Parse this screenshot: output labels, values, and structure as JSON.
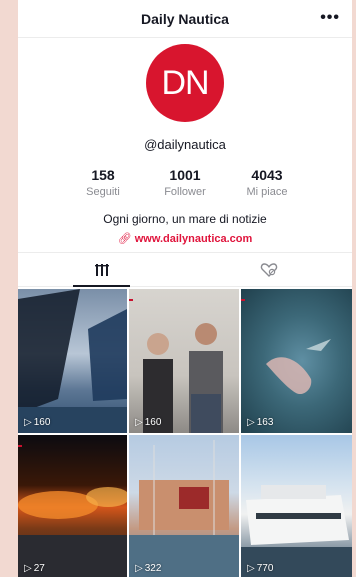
{
  "header": {
    "title": "Daily Nautica",
    "more_label": "•••"
  },
  "profile": {
    "avatar_text": "DN",
    "handle": "@dailynautica",
    "stats": [
      {
        "value": "158",
        "label": "Seguiti"
      },
      {
        "value": "1001",
        "label": "Follower"
      },
      {
        "value": "4043",
        "label": "Mi piace"
      }
    ],
    "bio": "Ogni giorno, un mare di notizie",
    "link": "www.dailynautica.com"
  },
  "videos": [
    {
      "views": "160",
      "icon": "play-icon"
    },
    {
      "views": "160",
      "icon": "play-icon"
    },
    {
      "views": "163",
      "icon": "play-icon"
    },
    {
      "views": "27",
      "icon": "play-icon"
    },
    {
      "views": "322",
      "icon": "play-icon"
    },
    {
      "views": "770",
      "icon": "play-icon"
    }
  ],
  "colors": {
    "brand": "#d8152e",
    "link": "#e0143c"
  }
}
